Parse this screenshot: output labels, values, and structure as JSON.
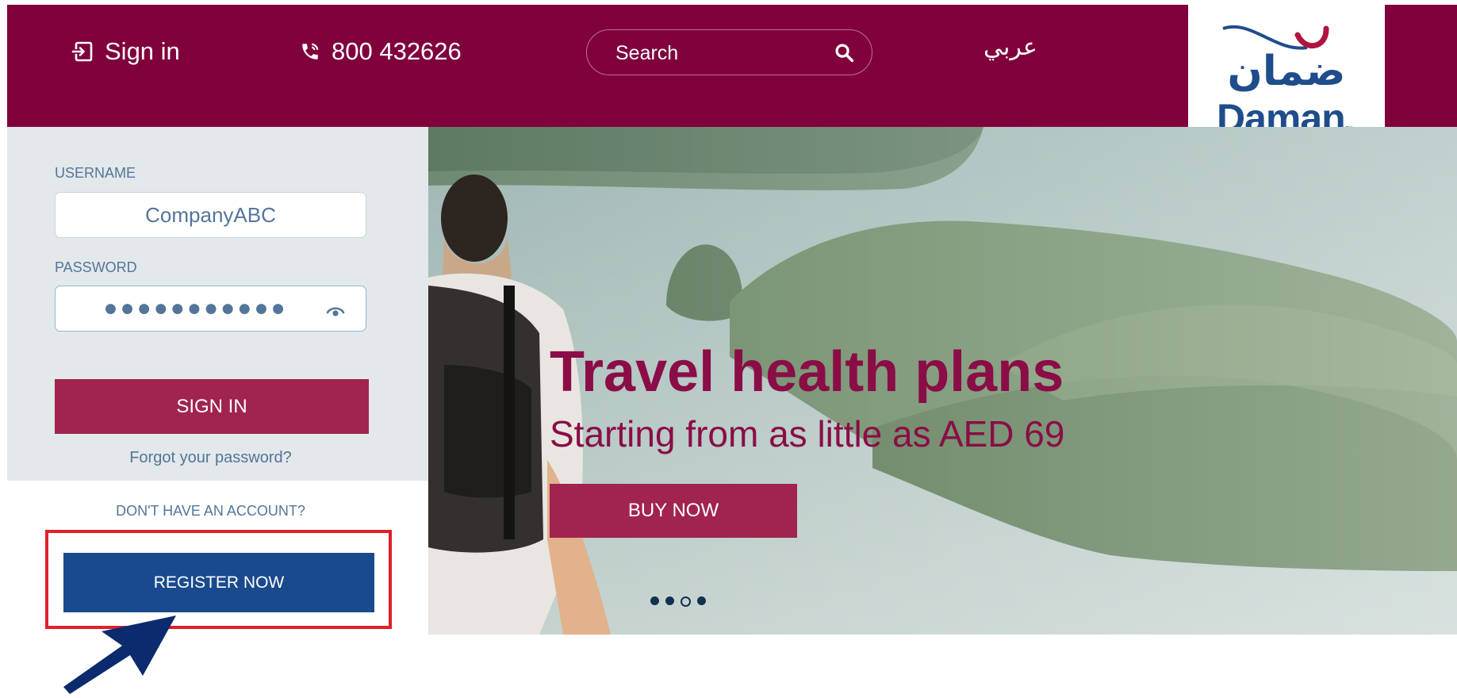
{
  "header": {
    "signin_label": "Sign in",
    "phone": "800 432626",
    "search_placeholder": "Search",
    "language_label": "عربي",
    "logo_arabic": "ضمان",
    "logo_latin": "Daman",
    "logo_tm": "™"
  },
  "login": {
    "username_label": "USERNAME",
    "username_value": "CompanyABC",
    "password_label": "PASSWORD",
    "password_value": "●●●●●●●●●●●",
    "signin_button": "SIGN IN",
    "forgot_link": "Forgot your password?",
    "no_account_text": "DON'T HAVE AN ACCOUNT?",
    "register_button": "REGISTER NOW"
  },
  "hero": {
    "title": "Travel health plans",
    "subtitle": "Starting from as little as AED 69",
    "cta_button": "BUY NOW",
    "carousel_slides": 4,
    "carousel_active_index": 2
  },
  "colors": {
    "brand_maroon": "#80003c",
    "button_rose": "#a1234f",
    "register_blue": "#1a4a8e",
    "highlight_red": "#e0202a",
    "label_blue": "#54759a"
  },
  "icons": {
    "signin": "sign-in-icon",
    "phone": "phone-icon",
    "search": "search-icon",
    "eye": "eye-icon",
    "annotation_arrow": "cursor-arrow-icon"
  }
}
